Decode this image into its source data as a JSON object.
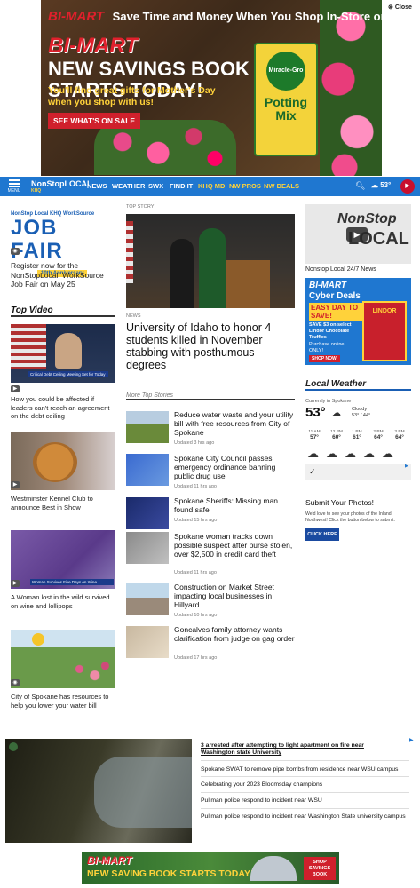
{
  "top_ad": {
    "brand": "BI-MART",
    "tagline": "Save Time and Money When You Shop In-Store or Online",
    "headline": "NEW SAVINGS BOOK STARTS TODAY!",
    "sub": "You'll find great gifts for Mother's Day when you shop with us!",
    "cta": "SEE WHAT'S ON SALE",
    "product_brand": "Miracle-Gro",
    "product_name": "Potting Mix",
    "close": "Close"
  },
  "nav": {
    "menu": "MENU",
    "logo": "NonStopLOCAL",
    "logo_sub": "KHQ",
    "items": [
      "NEWS",
      "WEATHER",
      "SWX",
      "FIND IT",
      "KHQ MD",
      "NW PROS",
      "NW DEALS"
    ],
    "temp": "53°"
  },
  "job_fair": {
    "small": "NonStop Local KHQ WorkSource",
    "big": "JOB FAIR",
    "anniv": "10th Anniversary",
    "caption": "Register now for the NonStopLocal, WorkSource Job Fair on May 25"
  },
  "top_video": {
    "title": "Top Video",
    "items": [
      {
        "caption": "How you could be affected if leaders can't reach an agreement on the debt ceiling",
        "banner": "Critical Debt Ceiling Meeting Set for Today"
      },
      {
        "caption": "Westminster Kennel Club to announce Best in Show",
        "banner": ""
      },
      {
        "caption": "A Woman lost in the wild survived on wine and lollipops",
        "banner": "Woman Survives Five Days on Wine"
      },
      {
        "caption": "City of Spokane has resources to help you lower your water bill",
        "banner": ""
      }
    ]
  },
  "top_story": {
    "label": "TOP STORY",
    "news_label": "NEWS",
    "headline": "University of Idaho to honor 4 students killed in November stabbing with posthumous degrees"
  },
  "more_stories": {
    "title": "More Top Stories",
    "items": [
      {
        "title": "Reduce water waste and your utility bill with free resources from City of Spokane",
        "time": "Updated 3 hrs ago"
      },
      {
        "title": "Spokane City Council passes emergency ordinance banning public drug use",
        "time": "Updated 11 hrs ago"
      },
      {
        "title": "Spokane Sheriffs: Missing man found safe",
        "time": "Updated 15 hrs ago"
      },
      {
        "title": "Spokane woman tracks down possible suspect after purse stolen, over $2,500 in credit card theft",
        "time": "Updated 11 hrs ago"
      },
      {
        "title": "Construction on Market Street impacting local businesses in Hillyard",
        "time": "Updated 10 hrs ago"
      },
      {
        "title": "Goncalves family attorney wants clarification from judge on gag order",
        "time": "Updated 17 hrs ago"
      }
    ]
  },
  "nsl247": {
    "logo_a": "NonStop",
    "logo_b": "LOCAL",
    "caption": "Nonstop Local 24/7 News"
  },
  "bimart_deals": {
    "brand": "BI-MART",
    "title": "Cyber Deals",
    "tag": "EASY DAY TO SAVE!",
    "offer": "SAVE $3 on select Lindor Chocolate Truffles",
    "note": "Purchase online ONLY!",
    "cta": "SHOP NOW!",
    "product": "LINDOR"
  },
  "weather": {
    "title": "Local Weather",
    "location": "Currently in Spokane",
    "temp": "53°",
    "condition": "Cloudy",
    "hilo": "53° / 44°",
    "hours": [
      {
        "time": "11 AM",
        "temp": "57°"
      },
      {
        "time": "12 PM",
        "temp": "60°"
      },
      {
        "time": "1 PM",
        "temp": "61°"
      },
      {
        "time": "2 PM",
        "temp": "64°"
      },
      {
        "time": "3 PM",
        "temp": "64°"
      }
    ]
  },
  "submit": {
    "title": "Submit Your Photos!",
    "text": "We'd love to see your photos of the Inland Northwest! Click the button below to submit.",
    "button": "CLICK HERE"
  },
  "bottom_headlines": {
    "items": [
      "3 arrested after attempting to light apartment on fire near Washington state University",
      "Spokane SWAT to remove pipe bombs from residence near WSU campus",
      "Celebrating your 2023 Bloomsday champions",
      "Pullman police respond to incident near WSU",
      "Pullman police respond to incident near Washington State university campus"
    ]
  },
  "bottom_ad": {
    "brand": "BI-MART",
    "text": "NEW SAVING BOOK STARTS TODAY!",
    "cta": "SHOP SAVINGS BOOK"
  },
  "colors": {
    "nav_blue": "#1f77d0",
    "brand_red": "#e0202c",
    "accent_gold": "#ffd23a",
    "link_blue": "#1a5fb4"
  }
}
